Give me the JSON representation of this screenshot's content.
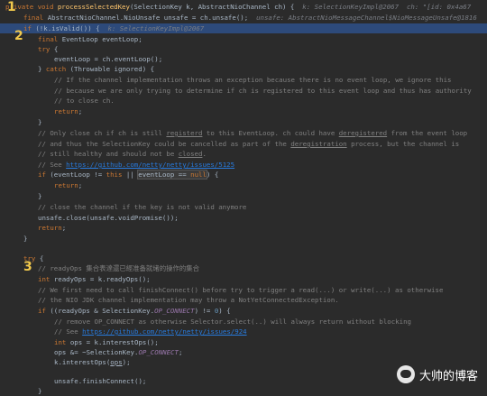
{
  "code": {
    "l1_kw1": "private void ",
    "l1_fn": "processSelectedKey",
    "l1_params": "(SelectionKey k, AbstractNioChannel ch) {",
    "l1_hint": "  k: SelectionKeyImpl@2067  ch: \"[id: 0x4a67",
    "l2_kw": "final ",
    "l2_text": "AbstractNioChannel.NioUnsafe unsafe = ch.unsafe();",
    "l2_hint": "  unsafe: AbstractNioMessageChannel$NioMessageUnsafe@1816",
    "l3_kw": "if ",
    "l3_text": "(!k.isValid()) {",
    "l3_hint": "  k: SelectionKeyImpl@2067",
    "l4_kw": "final ",
    "l4_text": "EventLoop eventLoop;",
    "l5_kw": "try ",
    "l5_text": "{",
    "l6": "eventLoop = ch.eventLoop();",
    "l7_a": "} ",
    "l7_kw": "catch ",
    "l7_b": "(Throwable ignored) {",
    "l8": "// If the channel implementation throws an exception because there is no event loop, we ignore this",
    "l9": "// because we are only trying to determine if ch is registered to this event loop and thus has authority",
    "l10": "// to close ch.",
    "l11_kw": "return",
    "l11_b": ";",
    "l12": "}",
    "l13_a": "// Only close ch if ch is still ",
    "l13_u1": "registerd",
    "l13_b": " to this EventLoop. ch could have ",
    "l13_u2": "deregistered",
    "l13_c": " from the event loop",
    "l14_a": "// and thus the SelectionKey could be cancelled as part of the ",
    "l14_u": "deregistration",
    "l14_b": " process, but the channel is",
    "l15_a": "// still healthy and should not be ",
    "l15_u": "closed",
    "l15_b": ".",
    "l16_a": "// See ",
    "l16_link": "https://github.com/netty/netty/issues/5125",
    "l17_kw1": "if ",
    "l17_a": "(eventLoop != ",
    "l17_kw2": "this ",
    "l17_b": "|| ",
    "l17_box": "eventLoop == ",
    "l17_kw3": "null",
    "l17_c": ") {",
    "l18_kw": "return",
    "l18_b": ";",
    "l19": "}",
    "l20": "// close the channel if the key is not valid anymore",
    "l21": "unsafe.close(unsafe.voidPromise());",
    "l22_kw": "return",
    "l22_b": ";",
    "l23": "}",
    "l24_kw": "try ",
    "l24_b": "{",
    "l25": "// readyOps 集合表達還已經准备就绪的操作的集合",
    "l26_kw": "int ",
    "l26_b": "readyOps = k.readyOps();",
    "l27": "// We first need to call finishConnect() before try to trigger a read(...) or write(...) as otherwise",
    "l28": "// the NIO JDK channel implementation may throw a NotYetConnectedException.",
    "l29_kw": "if ",
    "l29_a": "((readyOps & SelectionKey.",
    "l29_it": "OP_CONNECT",
    "l29_b": ") != ",
    "l29_num": "0",
    "l29_c": ") {",
    "l30": "// remove OP_CONNECT as otherwise Selector.select(..) will always return without blocking",
    "l31_a": "// See ",
    "l31_link": "https://github.com/netty/netty/issues/924",
    "l32_kw": "int ",
    "l32_b": "ops = k.interestOps();",
    "l33_a": "ops &= ~SelectionKey.",
    "l33_it": "OP_CONNECT",
    "l33_b": ";",
    "l34_a": "k.interestOps(",
    "l34_u": "ops",
    "l34_b": ");",
    "l35": "unsafe.finishConnect();",
    "l36": "}"
  },
  "markers": {
    "m1": "1",
    "m2": "2",
    "m3": "3"
  },
  "watermark": {
    "text": "大帅的博客",
    "icon": "wechat-icon"
  }
}
